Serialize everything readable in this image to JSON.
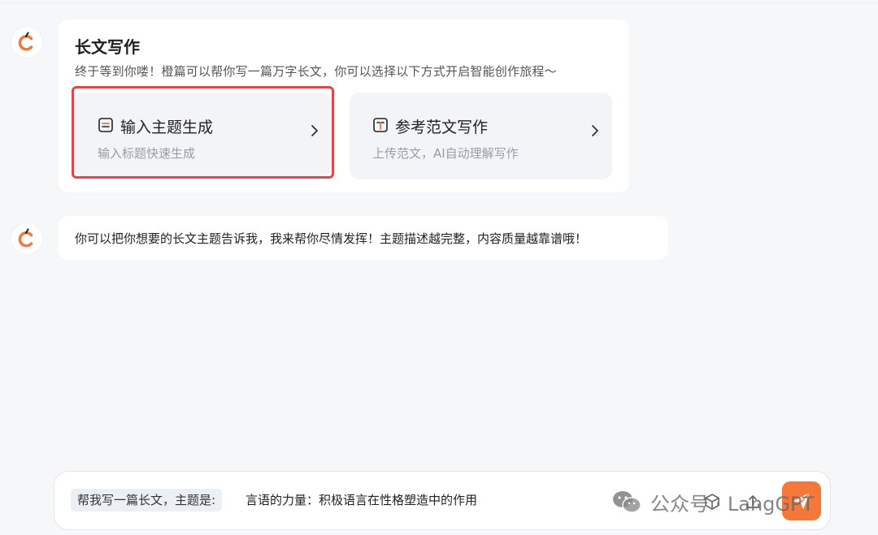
{
  "assistant": {
    "avatar_icon": "orange-c-logo-icon"
  },
  "writing_card": {
    "title": "长文写作",
    "subtitle": "终于等到你喽！橙篇可以帮你写一篇万字长文，你可以选择以下方式开启智能创作旅程～",
    "options": [
      {
        "icon": "document-lines-icon",
        "title": "输入主题生成",
        "desc": "输入标题快速生成",
        "highlighted": true
      },
      {
        "icon": "text-t-icon",
        "title": "参考范文写作",
        "desc": "上传范文，AI自动理解写作",
        "highlighted": false
      }
    ]
  },
  "reply": {
    "text": "你可以把你想要的长文主题告诉我，我来帮你尽情发挥！主题描述越完整，内容质量越靠谱哦！"
  },
  "input": {
    "prefix": "帮我写一篇长文，主题是:",
    "value": "言语的力量：积极语言在性格塑造中的作用",
    "tools": [
      "cube-icon",
      "upload-icon"
    ],
    "send_icon": "paper-plane-icon"
  },
  "watermark": {
    "text": "公众号 · LangGPT"
  },
  "colors": {
    "accent": "#f5773a",
    "highlight_border": "#e64545",
    "background": "#f6f7f9",
    "card": "#ffffff",
    "option": "#f3f4f7"
  }
}
